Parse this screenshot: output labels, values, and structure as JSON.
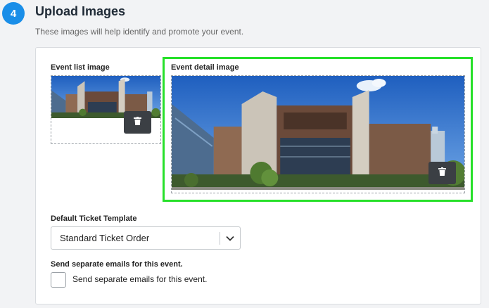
{
  "section": {
    "step_number": "4",
    "title": "Upload Images",
    "subtitle": "These images will help identify and promote your event."
  },
  "images": {
    "list_label": "Event list image",
    "detail_label": "Event detail image",
    "delete_icon": "trash-icon"
  },
  "ticket_template": {
    "label": "Default Ticket Template",
    "selected": "Standard Ticket Order"
  },
  "emails": {
    "heading": "Send separate emails for this event.",
    "checkbox_label": "Send separate emails for this event.",
    "checked": false
  },
  "colors": {
    "accent": "#1a8ee8",
    "highlight": "#27e02a",
    "button_dark": "#3b3f44"
  }
}
